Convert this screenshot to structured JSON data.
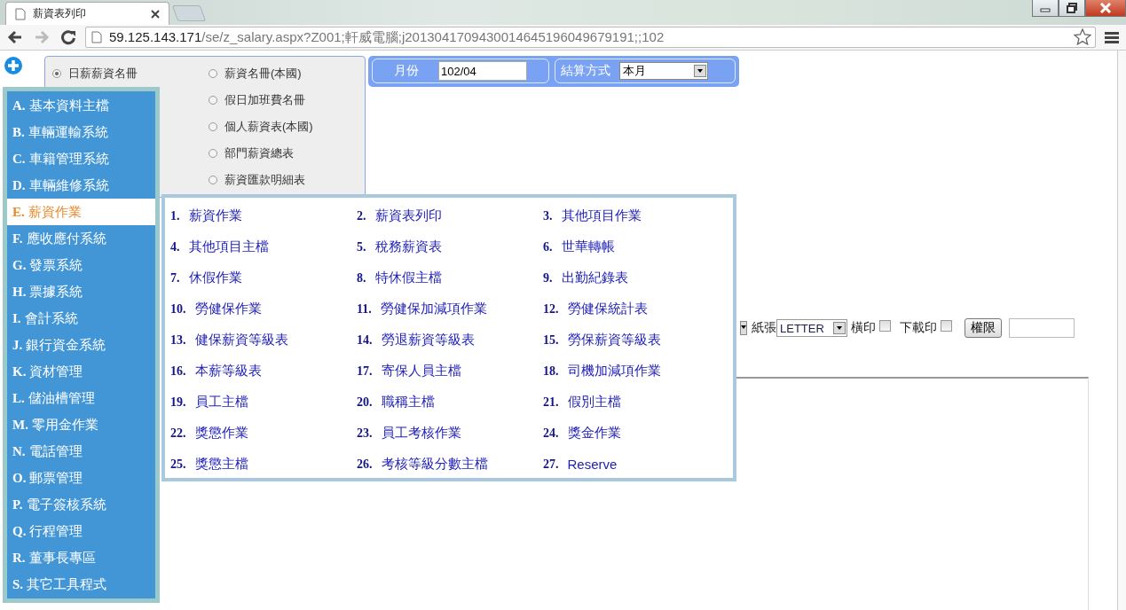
{
  "browser": {
    "tab_title": "薪資表列印",
    "url_host": "59.125.143.171",
    "url_path": "/se/z_salary.aspx?Z001;軒威電腦;j2013041709430014645196049679191;;102"
  },
  "report_types_left": [
    {
      "label": "日薪薪資名冊",
      "selected": true
    }
  ],
  "report_types_right": [
    {
      "label": "薪資名冊(本國)",
      "selected": false
    },
    {
      "label": "假日加班費名冊",
      "selected": false
    },
    {
      "label": "個人薪資表(本國)",
      "selected": false
    },
    {
      "label": "部門薪資總表",
      "selected": false
    },
    {
      "label": "薪資匯款明細表",
      "selected": false
    }
  ],
  "filters": [
    {
      "kind": "text",
      "label": "月份",
      "value": "102/04"
    },
    {
      "kind": "select",
      "label": "結算方式",
      "value": "本月"
    }
  ],
  "print_options": {
    "paper_label": "紙張",
    "paper_value": "LETTER",
    "landscape_label": "橫印",
    "landscape_checked": false,
    "download_label": "下載印",
    "download_checked": false,
    "permission_button": "權限"
  },
  "main_menu": [
    {
      "letter": "A.",
      "label": "基本資料主檔",
      "selected": false
    },
    {
      "letter": "B.",
      "label": "車輛運輸系統",
      "selected": false
    },
    {
      "letter": "C.",
      "label": "車籍管理系統",
      "selected": false
    },
    {
      "letter": "D.",
      "label": "車輛維修系統",
      "selected": false
    },
    {
      "letter": "E.",
      "label": "薪資作業",
      "selected": true
    },
    {
      "letter": "F.",
      "label": "應收應付系統",
      "selected": false
    },
    {
      "letter": "G.",
      "label": "發票系統",
      "selected": false
    },
    {
      "letter": "H.",
      "label": "票據系統",
      "selected": false
    },
    {
      "letter": "I.",
      "label": "會計系統",
      "selected": false
    },
    {
      "letter": "J.",
      "label": "銀行資金系統",
      "selected": false
    },
    {
      "letter": "K.",
      "label": "資材管理",
      "selected": false
    },
    {
      "letter": "L.",
      "label": "儲油槽管理",
      "selected": false
    },
    {
      "letter": "M.",
      "label": "零用金作業",
      "selected": false
    },
    {
      "letter": "N.",
      "label": "電話管理",
      "selected": false
    },
    {
      "letter": "O.",
      "label": "郵票管理",
      "selected": false
    },
    {
      "letter": "P.",
      "label": "電子簽核系統",
      "selected": false
    },
    {
      "letter": "Q.",
      "label": "行程管理",
      "selected": false
    },
    {
      "letter": "R.",
      "label": "董事長專區",
      "selected": false
    },
    {
      "letter": "S.",
      "label": "其它工具程式",
      "selected": false
    }
  ],
  "submenu": [
    {
      "number": "1.",
      "label": "薪資作業"
    },
    {
      "number": "2.",
      "label": "薪資表列印"
    },
    {
      "number": "3.",
      "label": "其他項目作業"
    },
    {
      "number": "4.",
      "label": "其他項目主檔"
    },
    {
      "number": "5.",
      "label": "稅務薪資表"
    },
    {
      "number": "6.",
      "label": "世華轉帳"
    },
    {
      "number": "7.",
      "label": "休假作業"
    },
    {
      "number": "8.",
      "label": "特休假主檔"
    },
    {
      "number": "9.",
      "label": "出勤紀錄表"
    },
    {
      "number": "10.",
      "label": "勞健保作業"
    },
    {
      "number": "11.",
      "label": "勞健保加減項作業"
    },
    {
      "number": "12.",
      "label": "勞健保統計表"
    },
    {
      "number": "13.",
      "label": "健保薪資等級表"
    },
    {
      "number": "14.",
      "label": "勞退薪資等級表"
    },
    {
      "number": "15.",
      "label": "勞保薪資等級表"
    },
    {
      "number": "16.",
      "label": "本薪等級表"
    },
    {
      "number": "17.",
      "label": "寄保人員主檔"
    },
    {
      "number": "18.",
      "label": "司機加減項作業"
    },
    {
      "number": "19.",
      "label": "員工主檔"
    },
    {
      "number": "20.",
      "label": "職稱主檔"
    },
    {
      "number": "21.",
      "label": "假別主檔"
    },
    {
      "number": "22.",
      "label": "獎懲作業"
    },
    {
      "number": "23.",
      "label": "員工考核作業"
    },
    {
      "number": "24.",
      "label": "獎金作業"
    },
    {
      "number": "25.",
      "label": "獎懲主檔"
    },
    {
      "number": "26.",
      "label": "考核等級分數主檔"
    },
    {
      "number": "27.",
      "label": "Reserve"
    }
  ]
}
